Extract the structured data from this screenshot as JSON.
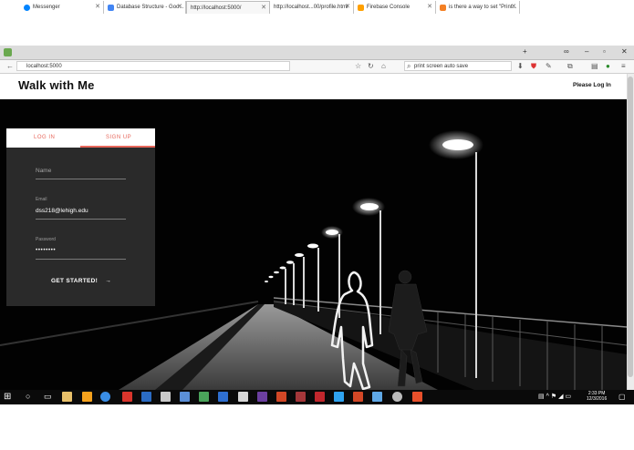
{
  "browser": {
    "tabs": [
      {
        "label": "Messenger",
        "color": "#0084ff"
      },
      {
        "label": "Database Structure - Goo...",
        "color": "#4285f4"
      },
      {
        "label": "http://localhost:5000/",
        "color": "#ffffff"
      },
      {
        "label": "http://localhost...00/profile.html",
        "color": "#ffffff"
      },
      {
        "label": "Firebase Console",
        "color": "#ffa000"
      },
      {
        "label": "is there a way to set \"Print...",
        "color": "#f48024"
      }
    ],
    "url": "localhost:5000",
    "search": "print screen auto save"
  },
  "site": {
    "brand": "Walk with Me",
    "login_link": "Please Log In"
  },
  "form": {
    "tab_login": "LOG IN",
    "tab_signup": "SIGN UP",
    "name_placeholder": "Name",
    "email_label": "Email",
    "email_value": "dss218@lehigh.edu",
    "password_label": "Password",
    "password_value": "••••••••",
    "submit_label": "GET STARTED!",
    "accent_color": "#e7685c"
  },
  "taskbar": {
    "time": "2:33 PM",
    "date": "12/3/2016"
  }
}
